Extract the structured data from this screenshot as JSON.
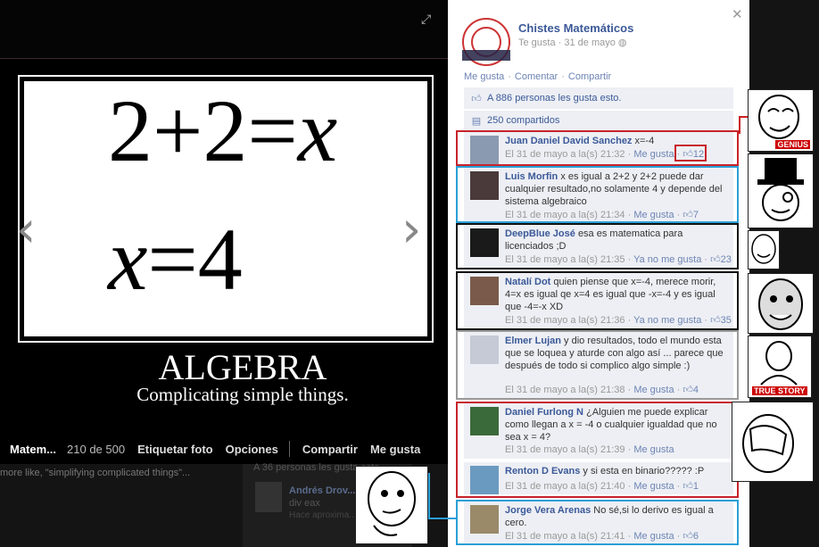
{
  "viewer": {
    "equation_line1_prefix": "2+2=",
    "equation_line1_var": "x",
    "equation_line2_var": "x",
    "equation_line2_suffix": "=4",
    "title": "ALGEBRA",
    "subtitle": "Complicating simple things.",
    "album": "Matem...",
    "position": "210 de 500",
    "actions": [
      "Etiquetar foto",
      "Opciones",
      "Compartir",
      "Me gusta"
    ],
    "under_text": "more like, \"simplifying complicated things\"...",
    "ghost_like": "A 36 personas les gusta esto.",
    "ghost_name": "Andrés Drov...",
    "ghost_sub": "div eax",
    "ghost_time": "Hace aproxima..."
  },
  "panel": {
    "page_name": "Chistes Matemáticos",
    "page_meta": "Te gusta · 31 de mayo",
    "actions": [
      "Me gusta",
      "Comentar",
      "Compartir"
    ],
    "likes": "A 886 personas les gusta esto.",
    "shares": "250 compartidos"
  },
  "comments": [
    {
      "name": "Juan Daniel David Sanchez",
      "text": "x=-4",
      "time": "El 31 de mayo a la(s) 21:32",
      "like_label": "Me gusta",
      "likes": "12"
    },
    {
      "name": "Luis Morfin",
      "text": "x es igual a 2+2 y 2+2 puede dar cualquier resultado,no solamente 4 y depende del sistema algebraico",
      "time": "El 31 de mayo a la(s) 21:34",
      "like_label": "Me gusta",
      "likes": "7"
    },
    {
      "name": "DeepBlue José",
      "text": "esa es matematica para licenciados ;D",
      "time": "El 31 de mayo a la(s) 21:35",
      "like_label": "Ya no me gusta",
      "likes": "23"
    },
    {
      "name": "Natalí Dot",
      "text": "quien piense que x=-4, merece morir, 4=x es igual qe x=4 es igual que -x=-4 y es igual que -4=-x XD",
      "time": "El 31 de mayo a la(s) 21:36",
      "like_label": "Ya no me gusta",
      "likes": "35"
    },
    {
      "name": "Elmer Lujan",
      "text": "y dio resultados, todo el mundo esta que se loquea y aturde con algo así ... parece que después de todo si complico algo simple :)",
      "time": "El 31 de mayo a la(s) 21:38",
      "like_label": "Me gusta",
      "likes": "4"
    },
    {
      "name": "Daniel Furlong N",
      "text": "¿Alguien me puede explicar como llegan a x = -4 o cualquier igualdad que no sea x = 4?",
      "time": "El 31 de mayo a la(s) 21:39",
      "like_label": "Me gusta",
      "likes": ""
    },
    {
      "name": "Renton D Evans",
      "text": "y si esta en binario????? :P",
      "time": "El 31 de mayo a la(s) 21:40",
      "like_label": "Me gusta",
      "likes": "1"
    },
    {
      "name": "Jorge Vera Arenas",
      "text": "No sé,si lo derivo es igual a cero.",
      "time": "El 31 de mayo a la(s) 21:41",
      "like_label": "Me gusta",
      "likes": "6"
    }
  ],
  "rage_labels": {
    "genius": "GENIUS",
    "true_story": "TRUE STORY"
  },
  "colors": {
    "fb_blue": "#3b5998",
    "frame_red": "#c8232c",
    "frame_blue": "#2a9fd6",
    "frame_black": "#111111",
    "frame_gray": "#9a9a9a"
  }
}
